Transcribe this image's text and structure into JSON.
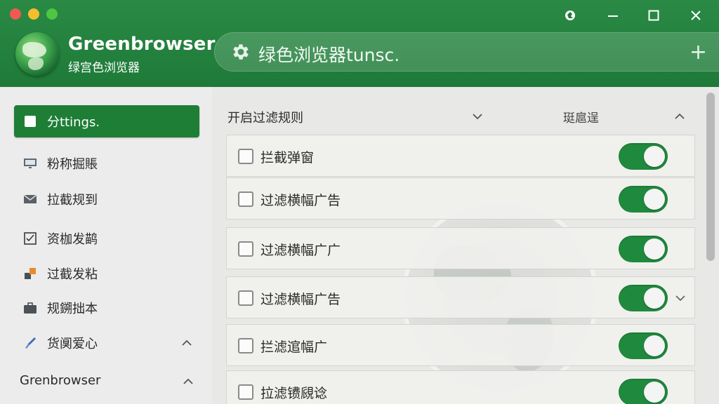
{
  "window": {
    "app_title": "Greenbrowser",
    "app_subtitle": "绿宫色浏览器",
    "address_text": "绿色浏览器tunsc.",
    "new_tab_symbol": "+"
  },
  "sidebar": {
    "items": [
      {
        "label": "分ttings.",
        "icon": "square-icon",
        "active": true
      },
      {
        "label": "粉称掘賬",
        "icon": "monitor-icon"
      },
      {
        "label": "拉截规到",
        "icon": "mail-icon"
      },
      {
        "label": "资枷发鹋",
        "icon": "checklist-icon"
      },
      {
        "label": "过截发粘",
        "icon": "blocks-icon"
      },
      {
        "label": "规鎙拙本",
        "icon": "briefcase-icon"
      },
      {
        "label": "货阒爱心",
        "icon": "brush-icon"
      }
    ],
    "footer_label": "Grenbrowser"
  },
  "main": {
    "section_title": "开启过滤规则",
    "section_right_label": "珽扈逞",
    "rules": [
      {
        "label": "拦截弹窗",
        "enabled": true
      },
      {
        "label": "过滤横幅广告",
        "enabled": true
      },
      {
        "label": "过滤横幅广广",
        "enabled": true
      },
      {
        "label": "过滤横幅广告",
        "enabled": true
      },
      {
        "label": "拦滤逭幅广",
        "enabled": true
      },
      {
        "label": "拉滤镄覛谂",
        "enabled": true
      }
    ]
  },
  "colors": {
    "brand_green": "#1e7a38",
    "active_item": "#1e7e36",
    "toggle_on": "#1f8a3e",
    "traffic_red": "#ee5a52",
    "traffic_yellow": "#f5bd2f",
    "traffic_green": "#4fc640"
  }
}
